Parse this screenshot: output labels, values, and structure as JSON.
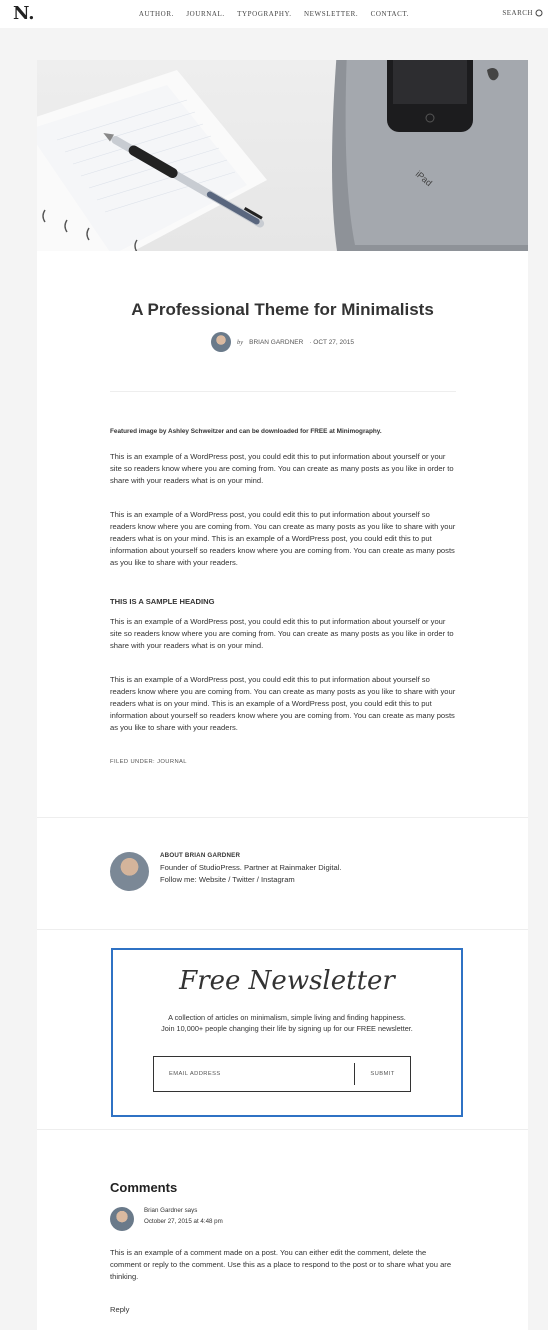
{
  "header": {
    "logo": "N.",
    "nav": [
      "AUTHOR.",
      "JOURNAL.",
      "TYPOGRAPHY.",
      "NEWSLETTER.",
      "CONTACT."
    ],
    "search_label": "SEARCH"
  },
  "hero": {
    "device_label": "iPad"
  },
  "post": {
    "title": "A Professional Theme for Minimalists",
    "by": "by",
    "author": "BRIAN GARDNER",
    "date": "· OCT 27, 2015",
    "caption": "Featured image by Ashley Schweitzer and can be downloaded for FREE at Minimography.",
    "paragraphs": [
      "This is an example of a WordPress post, you could edit this to put information about yourself or your site so readers know where you are coming from. You can create as many posts as you like in order to share with your readers what is on your mind.",
      "This is an example of a WordPress post, you could edit this to put information about yourself so readers know where you are coming from. You can create as many posts as you like to share with your readers what is on your mind. This is an example of a WordPress post, you could edit this to put information about yourself so readers know where you are coming from. You can create as many posts as you like to share with your readers.",
      "This is an example of a WordPress post, you could edit this to put information about yourself or your site so readers know where you are coming from. You can create as many posts as you like in order to share with your readers what is on your mind.",
      "This is an example of a WordPress post, you could edit this to put information about yourself so readers know where you are coming from. You can create as many posts as you like to share with your readers what is on your mind. This is an example of a WordPress post, you could edit this to put information about yourself so readers know where you are coming from. You can create as many posts as you like to share with your readers."
    ],
    "heading": "THIS IS A SAMPLE HEADING",
    "filed": "FILED UNDER: JOURNAL"
  },
  "author_box": {
    "name": "ABOUT BRIAN GARDNER",
    "bio_line1": "Founder of StudioPress. Partner at Rainmaker Digital.",
    "bio_line2": "Follow me: Website / Twitter / Instagram"
  },
  "newsletter": {
    "title": "Free Newsletter",
    "line1": "A collection of articles on minimalism, simple living and finding happiness.",
    "line2": "Join 10,000+ people changing their life by signing up for our FREE newsletter.",
    "email_placeholder": "EMAIL ADDRESS",
    "submit_label": "SUBMIT",
    "border_color": "#2f72c4"
  },
  "comments": {
    "title": "Comments",
    "author": "Brian Gardner says",
    "date": "October 27, 2015 at 4:48 pm",
    "body": "This is an example of a comment made on a post. You can either edit the comment, delete the comment or reply to the comment. Use this as a place to respond to the post or to share what you are thinking.",
    "reply_label": "Reply"
  }
}
